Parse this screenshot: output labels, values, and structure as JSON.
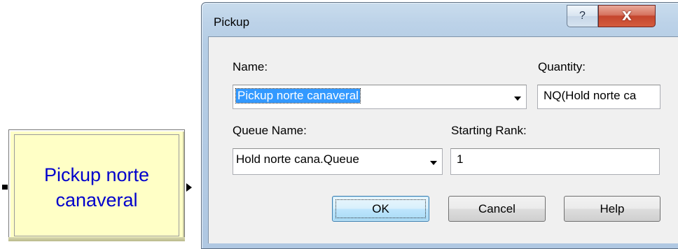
{
  "flowchart": {
    "module_label_line1": "Pickup norte",
    "module_label_line2": "canaveral"
  },
  "dialog": {
    "title": "Pickup",
    "help_glyph": "?",
    "close_glyph": "X",
    "fields": {
      "name_label": "Name:",
      "name_value": "Pickup norte canaveral",
      "quantity_label": "Quantity:",
      "quantity_value": "NQ(Hold norte ca",
      "queue_name_label": "Queue Name:",
      "queue_name_value": "Hold norte cana.Queue",
      "starting_rank_label": "Starting Rank:",
      "starting_rank_value": "1"
    },
    "buttons": {
      "ok_label": "OK",
      "cancel_label": "Cancel",
      "help_label": "Help"
    }
  },
  "colors": {
    "module_fill": "#ffffc6",
    "module_text": "#0000cc",
    "selection": "#3399ff",
    "close_button": "#c4452d",
    "title_bar": "#b5cde5"
  },
  "icons": {
    "help": "question-mark-icon",
    "close": "close-x-icon",
    "dropdown": "chevron-down-icon"
  }
}
